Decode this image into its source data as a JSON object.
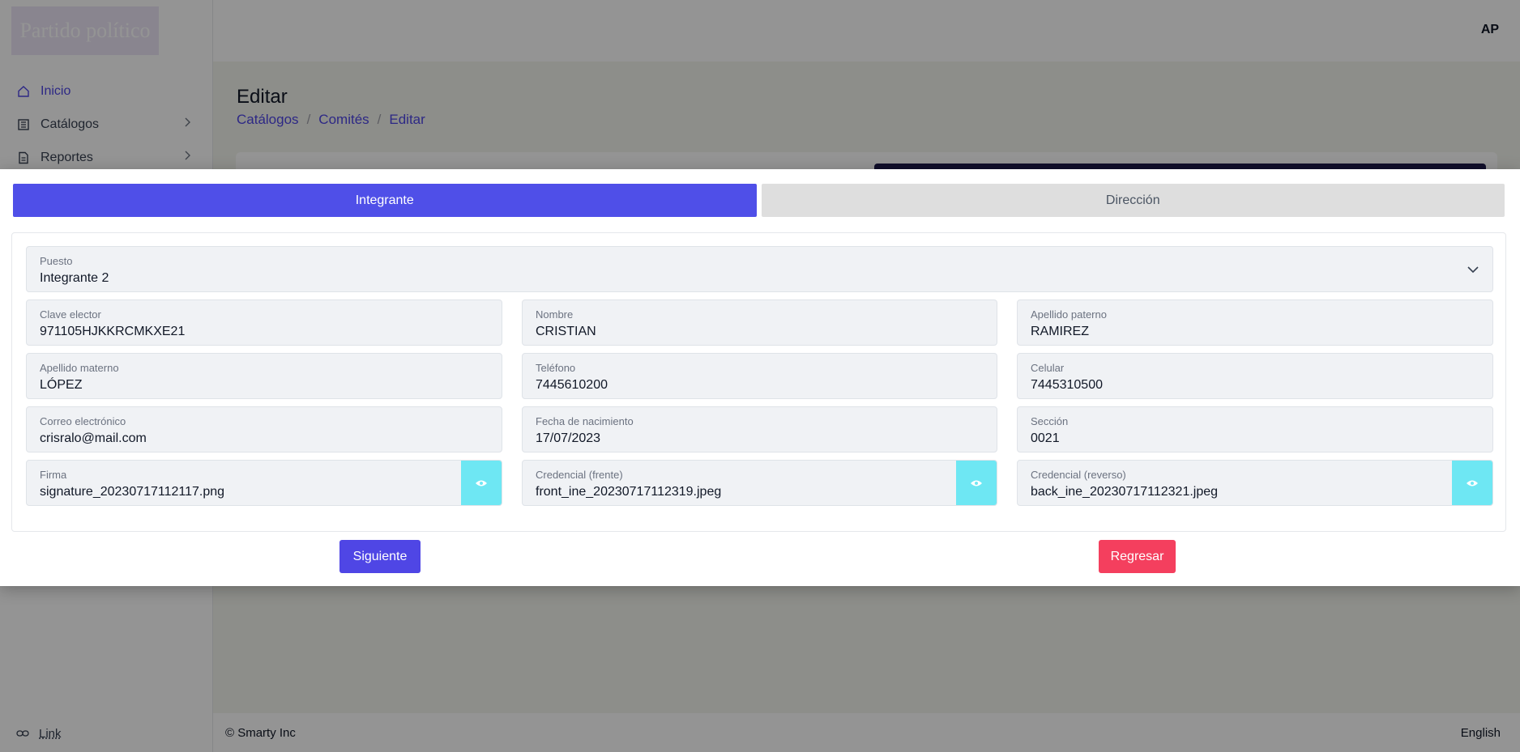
{
  "app": {
    "logo_text": "Partido político",
    "user_initials": "AP"
  },
  "sidebar": {
    "items": [
      {
        "label": "Inicio",
        "icon": "home-icon",
        "active": true
      },
      {
        "label": "Catálogos",
        "icon": "catalog-icon",
        "has_children": true
      },
      {
        "label": "Reportes",
        "icon": "report-icon",
        "has_children": true
      }
    ],
    "footer_link": "Link"
  },
  "page": {
    "title": "Editar",
    "breadcrumb": [
      "Catálogos",
      "Comités",
      "Editar"
    ]
  },
  "footer": {
    "copyright": "© Smarty Inc",
    "language": "English"
  },
  "modal": {
    "tabs": [
      {
        "label": "Integrante",
        "active": true
      },
      {
        "label": "Dirección",
        "active": false
      }
    ],
    "puesto": {
      "label": "Puesto",
      "value": "Integrante 2"
    },
    "fields": [
      {
        "label": "Clave elector",
        "value": "971105HJKKRCMKXE21"
      },
      {
        "label": "Nombre",
        "value": "CRISTIAN"
      },
      {
        "label": "Apellido paterno",
        "value": "RAMIREZ"
      },
      {
        "label": "Apellido materno",
        "value": "LÓPEZ"
      },
      {
        "label": "Teléfono",
        "value": "7445610200"
      },
      {
        "label": "Celular",
        "value": "7445310500"
      },
      {
        "label": "Correo electrónico",
        "value": "crisralo@mail.com"
      },
      {
        "label": "Fecha de nacimiento",
        "value": "17/07/2023"
      },
      {
        "label": "Sección",
        "value": "0021"
      }
    ],
    "files": [
      {
        "label": "Firma",
        "value": "signature_20230717112117.png",
        "icon": "eye-icon"
      },
      {
        "label": "Credencial (frente)",
        "value": "front_ine_20230717112319.jpeg",
        "icon": "eye-icon"
      },
      {
        "label": "Credencial (reverso)",
        "value": "back_ine_20230717112321.jpeg",
        "icon": "eye-icon"
      }
    ],
    "next_label": "Siguiente",
    "back_label": "Regresar"
  },
  "colors": {
    "primary": "#4f46e5",
    "danger": "#f43f5e",
    "info": "#6ee7f3",
    "field_bg": "#f0f2f5"
  }
}
